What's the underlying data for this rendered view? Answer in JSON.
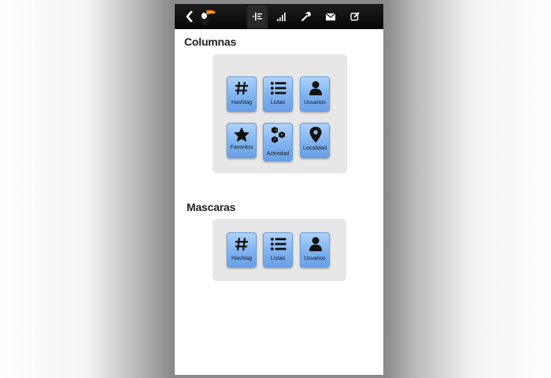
{
  "columnas": {
    "title": "Columnas",
    "items": [
      {
        "label": "Hashtag",
        "icon": "hash-icon"
      },
      {
        "label": "Listas",
        "icon": "list-icon"
      },
      {
        "label": "Usuarios",
        "icon": "user-icon"
      },
      {
        "label": "Favoritos",
        "icon": "star-icon"
      },
      {
        "label": "Actividad",
        "icon": "activity-icon"
      },
      {
        "label": "Localidad",
        "icon": "location-pin-icon"
      }
    ]
  },
  "mascaras": {
    "title": "Mascaras",
    "items": [
      {
        "label": "Hashtag",
        "icon": "hash-icon"
      },
      {
        "label": "Listas",
        "icon": "list-icon"
      },
      {
        "label": "Usuarios",
        "icon": "user-icon"
      }
    ]
  },
  "topbar": {
    "back_icon": "chevron-left-icon",
    "logo_icon": "toucan-logo",
    "nav": [
      "columns-icon",
      "signal-bars-icon",
      "wrench-icon",
      "envelope-icon",
      "compose-icon"
    ],
    "active_nav": "columns-icon"
  },
  "colors": {
    "topbar": "#0b0b0b",
    "tile": "#7fb2ef",
    "panel": "#e7e7e7"
  }
}
